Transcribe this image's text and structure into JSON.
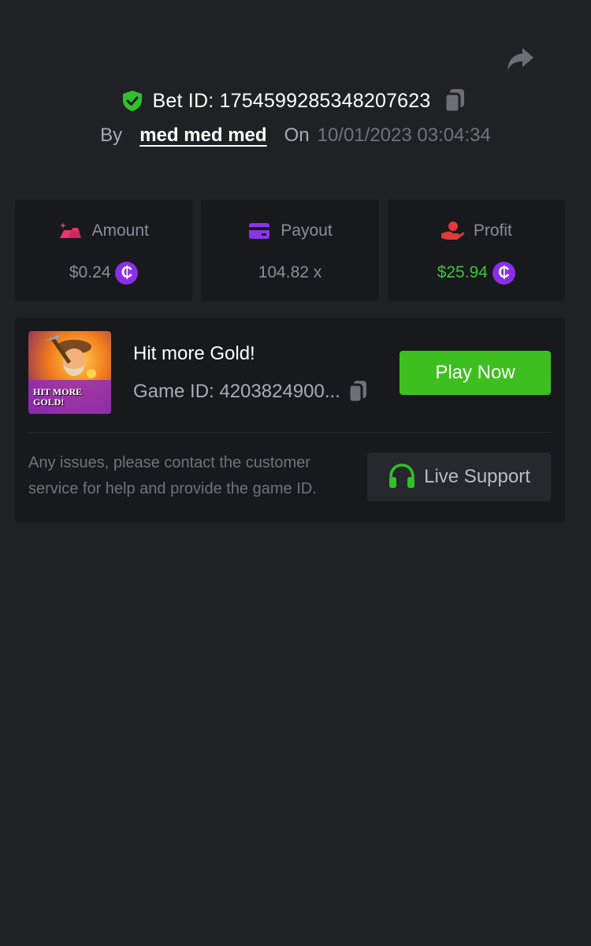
{
  "header": {
    "share_icon": "share-arrow-icon",
    "bet_label": "Bet ID: 1754599285348207623",
    "by_label": "By",
    "username": "med med med",
    "on_label": "On",
    "date": "10/01/2023 03:04:34"
  },
  "stats": [
    {
      "key": "amount",
      "label": "Amount",
      "value": "$0.24",
      "icon": "gold-bars-icon",
      "icon_color": "#e8356b",
      "value_color": "#8a8e96",
      "coin": "₵"
    },
    {
      "key": "payout",
      "label": "Payout",
      "value": "104.82 x",
      "icon": "card-icon",
      "icon_color": "#8b35e8",
      "value_color": "#8a8e96"
    },
    {
      "key": "profit",
      "label": "Profit",
      "value": "$25.94",
      "icon": "hand-coin-icon",
      "icon_color": "#e03a3a",
      "value_color": "#3dc43a",
      "coin": "₵"
    }
  ],
  "game": {
    "title": "Hit more Gold!",
    "game_id": "Game ID: 4203824900...",
    "thumbnail_text": "HIT MORE GOLD!",
    "play_label": "Play Now",
    "help_text": "Any issues, please contact the customer service for help and provide the game ID.",
    "support_label": "Live Support"
  },
  "colors": {
    "background": "#202124",
    "card": "#18191c",
    "accent_green": "#3dc01f",
    "coin_purple": "#8b2ee8"
  }
}
